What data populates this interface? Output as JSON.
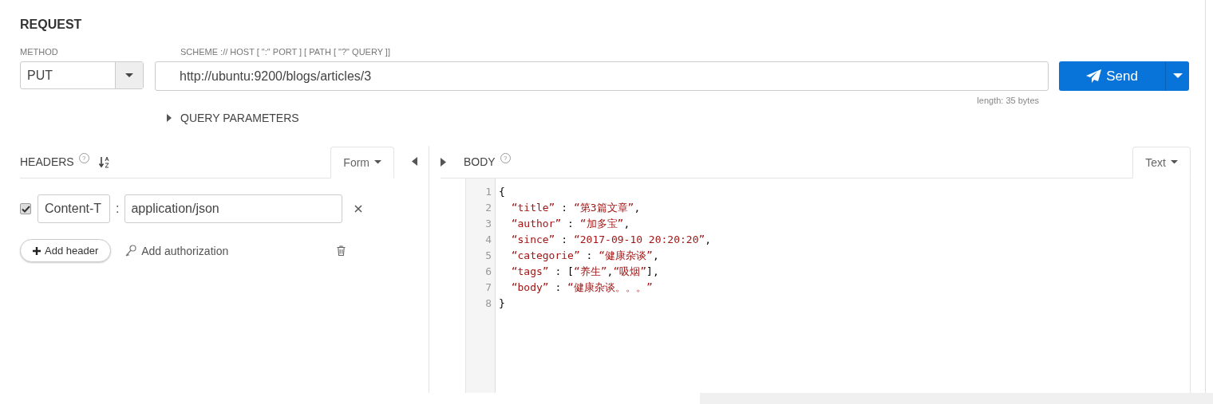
{
  "request": {
    "title": "REQUEST",
    "method_label": "METHOD",
    "method": "PUT",
    "url_label": "SCHEME :// HOST [ \":\" PORT ] [ PATH [ \"?\" QUERY ]]",
    "url": "http://ubuntu:9200/blogs/articles/3",
    "length": "length: 35 bytes",
    "send": "Send",
    "query_parameters": {
      "label": "QUERY PARAMETERS",
      "expanded": false
    }
  },
  "headers": {
    "title": "HEADERS",
    "help": "?",
    "mode": "Form",
    "rows": [
      {
        "checked": true,
        "name": "Content-T",
        "separator": ":",
        "value": "application/json"
      }
    ],
    "add_header": "Add header",
    "add_authorization": "Add authorization"
  },
  "body": {
    "title": "BODY",
    "help": "?",
    "mode": "Text",
    "lines": [
      {
        "number": "1",
        "text": "{"
      },
      {
        "number": "2",
        "text": "  “title” : “第3篇文章”,"
      },
      {
        "number": "3",
        "text": "  “author” : “加多宝”,"
      },
      {
        "number": "4",
        "text": "  “since” : “2017-09-10 20:20:20”,"
      },
      {
        "number": "5",
        "text": "  “categorie” : “健康杂谈”,"
      },
      {
        "number": "6",
        "text": "  “tags” : [“养生”,“吸烟”],"
      },
      {
        "number": "7",
        "text": "  “body” : “健康杂谈。。。”"
      },
      {
        "number": "8",
        "text": "}"
      }
    ]
  }
}
